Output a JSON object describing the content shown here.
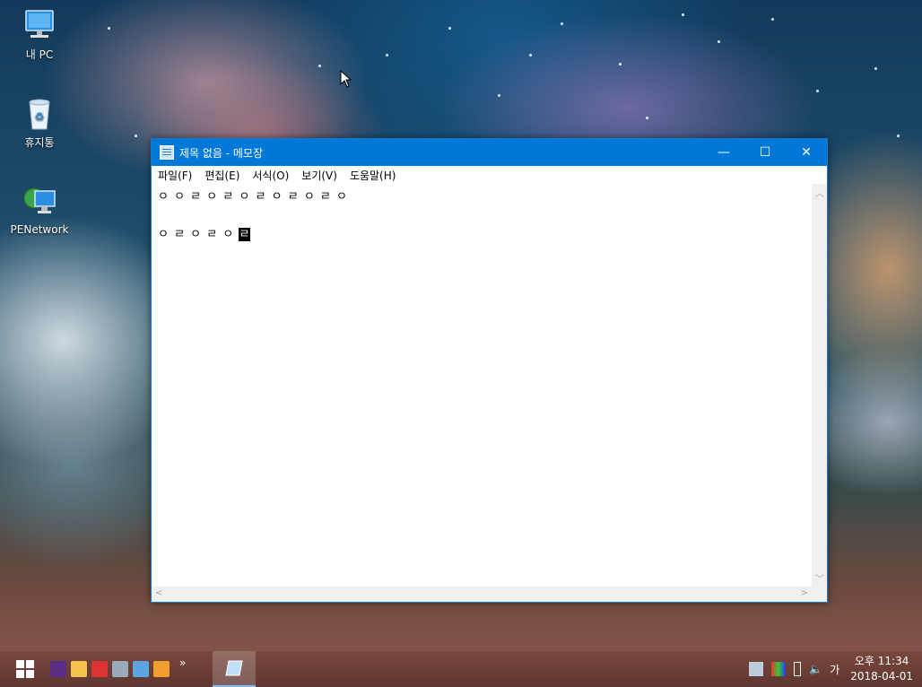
{
  "desktop": {
    "icons": [
      {
        "label": "내 PC",
        "icon": "computer-icon"
      },
      {
        "label": "휴지통",
        "icon": "recycle-bin-icon"
      },
      {
        "label": "PENetwork",
        "icon": "network-icon"
      }
    ]
  },
  "notepad": {
    "title": "제목 없음 - 메모장",
    "menu": [
      "파일(F)",
      "편집(E)",
      "서식(O)",
      "보기(V)",
      "도움말(H)"
    ],
    "lines": [
      "ㅇ ㅇ ㄹ ㅇ ㄹ ㅇ ㄹ ㅇ ㄹ ㅇ ㄹ ㅇ",
      "",
      "ㅇ ㄹ ㅇ ㄹ ㅇ "
    ],
    "selected_char": "ㄹ",
    "window_buttons": {
      "minimize": "—",
      "maximize": "☐",
      "close": "✕"
    }
  },
  "taskbar": {
    "start_icon": "windows-start-icon",
    "quicklaunch_more": "»",
    "tray": {
      "ime": "가",
      "time": "오후 11:34",
      "date": "2018-04-01"
    }
  },
  "colors": {
    "accent": "#0078d7",
    "taskbar": "#6a3c34"
  }
}
